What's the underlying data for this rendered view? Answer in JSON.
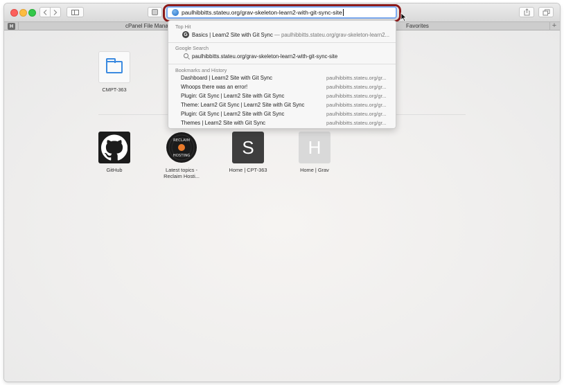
{
  "toolbar": {
    "back_icon": "chevron-left-icon",
    "forward_icon": "chevron-right-icon",
    "sidebar_icon": "sidebar-icon",
    "reader_icon": "reader-icon",
    "share_icon": "share-icon",
    "tabs_icon": "tabs-overview-icon"
  },
  "address": {
    "value": "paulhibbitts.stateu.org/grav-skeleton-learn2-with-git-sync-site",
    "icon": "globe-icon",
    "highlight_color": "#8b1a1a"
  },
  "tabs": [
    {
      "label": "H",
      "kind": "favicon"
    },
    {
      "label": "cPanel File Manag",
      "kind": "tab"
    },
    {
      "label": "Favorites",
      "kind": "tab"
    }
  ],
  "new_tab_label": "+",
  "suggestions": {
    "top_hit": {
      "section": "Top Hit",
      "title": "Basics | Learn2 Site with Git Sync",
      "url": " — paulhibbitts.stateu.org/grav-skeleton-learn2..."
    },
    "google": {
      "section": "Google Search",
      "query": "paulhibbitts.stateu.org/grav-skeleton-learn2-with-git-sync-site"
    },
    "bookmarks": {
      "section": "Bookmarks and History",
      "items": [
        {
          "title": "Dashboard | Learn2 Site with Git Sync",
          "url": "paulhibbitts.stateu.org/gr..."
        },
        {
          "title": "Whoops there was an error!",
          "url": "paulhibbitts.stateu.org/gr..."
        },
        {
          "title": "Plugin: Git Sync | Learn2 Site with Git Sync",
          "url": "paulhibbitts.stateu.org/gr..."
        },
        {
          "title": "Theme: Learn2 Git Sync | Learn2 Site with Git Sync",
          "url": "paulhibbitts.stateu.org/gr..."
        },
        {
          "title": "Plugin: Git Sync | Learn2 Site with Git Sync",
          "url": "paulhibbitts.stateu.org/gr..."
        },
        {
          "title": "Themes | Learn2 Site with Git Sync",
          "url": "paulhibbitts.stateu.org/gr..."
        }
      ]
    }
  },
  "favorites": {
    "folder": {
      "label": "CMPT-363",
      "icon": "folder-icon"
    },
    "sites": [
      {
        "label": "GitHub",
        "icon": "github-icon"
      },
      {
        "label": "Latest topics - Reclaim Hosti...",
        "icon": "reclaim-hosting-icon",
        "logo_text": "RECLAIM HOSTING"
      },
      {
        "label": "Home | CPT-363",
        "letter": "S"
      },
      {
        "label": "Home | Grav",
        "letter": "H"
      }
    ]
  }
}
